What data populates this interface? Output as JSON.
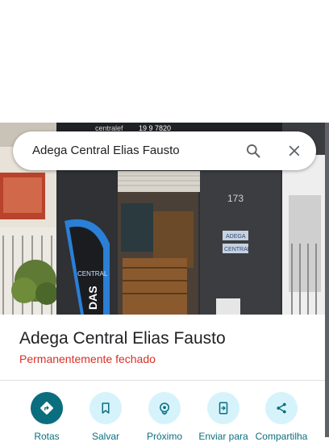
{
  "search": {
    "query": "Adega Central Elias Fausto"
  },
  "photo": {
    "house_number": "173",
    "sign_line1": "ADEGA",
    "sign_line2": "CENTRAL",
    "banner_text": "DAS",
    "banner_brand": "CENTRAL",
    "phone_fragment": "19 9 7820",
    "web_fragment": "centralef"
  },
  "place": {
    "name": "Adega Central Elias Fausto",
    "status": "Permanentemente fechado",
    "status_color": "#d93025"
  },
  "actions": [
    {
      "label": "Rotas",
      "icon": "directions-icon"
    },
    {
      "label": "Salvar",
      "icon": "bookmark-icon"
    },
    {
      "label": "Próximo",
      "icon": "nearby-icon"
    },
    {
      "label": "Enviar para",
      "icon": "send-to-phone-icon"
    },
    {
      "label": "Compartilha",
      "icon": "share-icon"
    }
  ],
  "colors": {
    "accent": "#0b6e7f",
    "action_bg": "#d6f3fb"
  }
}
